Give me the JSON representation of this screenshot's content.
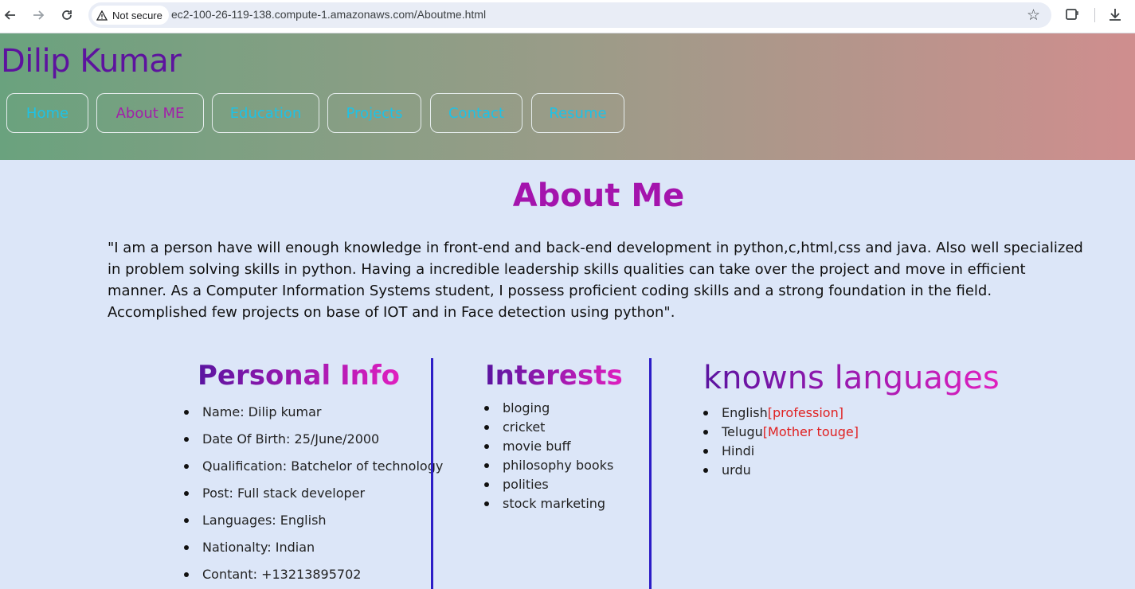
{
  "browser": {
    "security_label": "Not secure",
    "url": "ec2-100-26-119-138.compute-1.amazonaws.com/Aboutme.html"
  },
  "site": {
    "name": "Dilip Kumar",
    "nav": [
      {
        "label": "Home"
      },
      {
        "label": "About ME",
        "active": true
      },
      {
        "label": "Education"
      },
      {
        "label": "Projects"
      },
      {
        "label": "Contact"
      },
      {
        "label": "Resume"
      }
    ]
  },
  "main": {
    "title": "About Me",
    "bio": "\"I am a person have will enough knowledge in front-end and back-end development in python,c,html,css and java. Also well specialized in problem solving skills in python. Having a incredible leadership skills qualities can take over the project and move in efficient manner. As a Computer Information Systems student, I possess proficient coding skills and a strong foundation in the field. Accomplished few projects on base of IOT and in Face detection using python\"."
  },
  "personal": {
    "title": "Personal Info",
    "items": [
      "Name: Dilip kumar",
      "Date Of Birth: 25/June/2000",
      "Qualification: Batchelor of technology",
      "Post: Full stack developer",
      "Languages: English",
      "Nationalty: Indian",
      "Contant: +13213895702"
    ]
  },
  "interests": {
    "title": "Interests",
    "items": [
      "bloging",
      "cricket",
      "movie buff",
      "philosophy books",
      "polities",
      "stock marketing"
    ]
  },
  "languages": {
    "title": "knowns languages",
    "items": [
      {
        "name": "English",
        "note": "[profession]"
      },
      {
        "name": "Telugu",
        "note": "[Mother touge]"
      },
      {
        "name": "Hindi",
        "note": ""
      },
      {
        "name": "urdu",
        "note": ""
      }
    ]
  },
  "colors": {
    "nav_link": "#1ec2e6",
    "nav_active": "#a21fa9",
    "title": "#a414ad",
    "divider": "#2c1dc7",
    "note": "#e02020"
  }
}
